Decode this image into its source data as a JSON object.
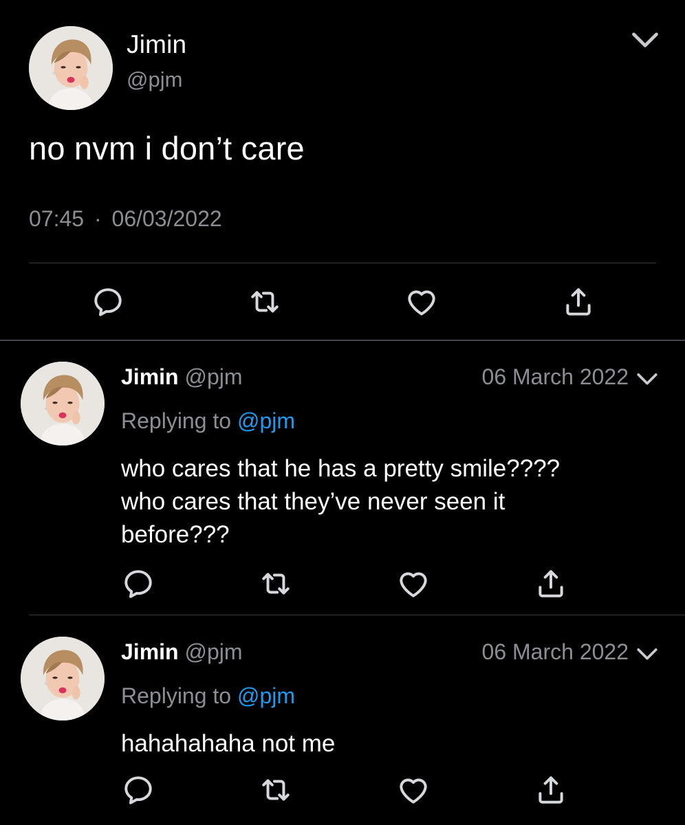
{
  "main_tweet": {
    "author_name": "Jimin",
    "author_handle": "@pjm",
    "text": "no nvm i don’t care",
    "time": "07:45",
    "separator": "·",
    "date": "06/03/2022",
    "actions": [
      "reply-icon",
      "retweet-icon",
      "like-icon",
      "share-icon"
    ]
  },
  "replies": [
    {
      "author_name": "Jimin",
      "author_handle": "@pjm",
      "date": "06 March 2022",
      "replying_prefix": "Replying to",
      "replying_to": "@pjm",
      "text_lines": [
        "who cares that he has a pretty smile????",
        "who cares that they’ve never seen it",
        "before???"
      ]
    },
    {
      "author_name": "Jimin",
      "author_handle": "@pjm",
      "date": "06 March 2022",
      "replying_prefix": "Replying to",
      "replying_to": "@pjm",
      "text_lines": [
        "hahahahaha not me"
      ]
    }
  ],
  "colors": {
    "background": "#000000",
    "text": "#ffffff",
    "secondary": "#8b8f94",
    "mention": "#1d9bf0",
    "divider": "#38393c"
  }
}
